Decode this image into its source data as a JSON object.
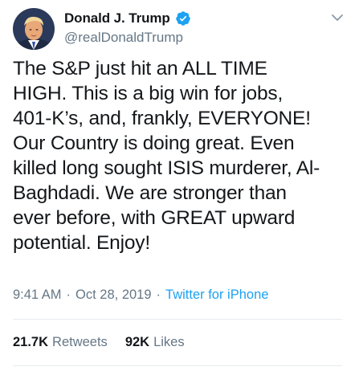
{
  "tweet": {
    "author_name": "Donald J. Trump",
    "handle": "@realDonaldTrump",
    "text": "The S&P just hit an ALL TIME\nHIGH. This is a big win for jobs,\n401-K’s, and, frankly, EVERYONE!\nOur Country is doing great. Even\nkilled long sought ISIS murderer, Al-\nBaghdadi. We are stronger than\never before, with GREAT upward\npotential. Enjoy!",
    "time": "9:41 AM",
    "separator": "·",
    "date": "Oct 28, 2019",
    "source": "Twitter for iPhone",
    "retweets_count": "21.7K",
    "retweets_label": "Retweets",
    "likes_count": "92K",
    "likes_label": "Likes"
  },
  "colors": {
    "accent": "#1da1f2",
    "secondary_text": "#657786",
    "primary_text": "#14171a",
    "divider": "#e6ecf0"
  },
  "icons": {
    "verified": "verified-badge-icon",
    "menu": "chevron-down-icon"
  }
}
